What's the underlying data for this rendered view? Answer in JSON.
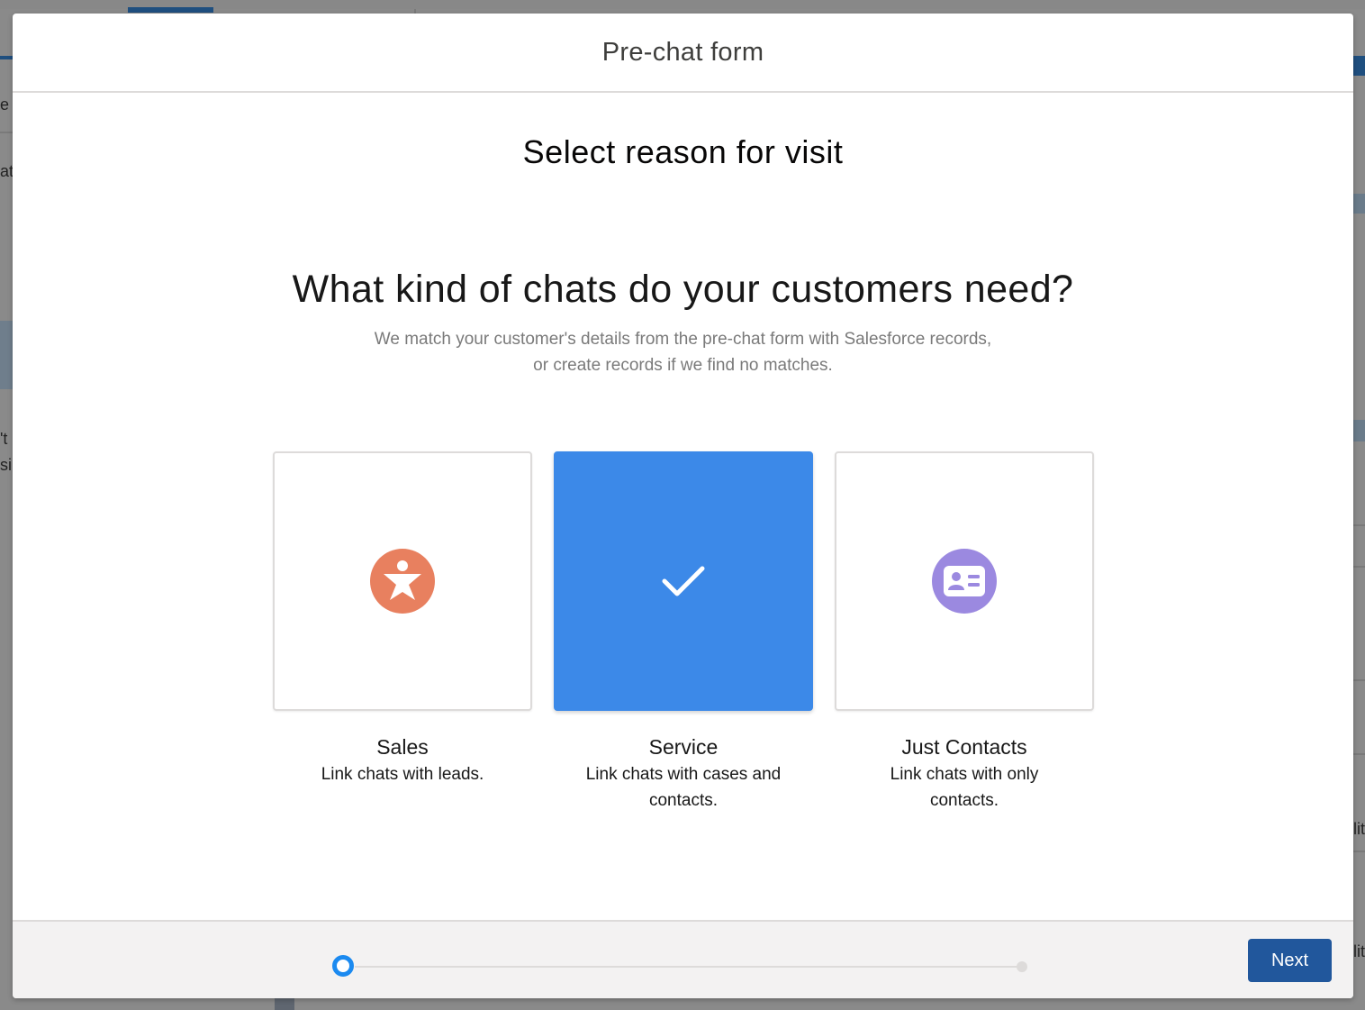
{
  "background": {
    "fragments": [
      {
        "text": "e"
      },
      {
        "text": "at"
      },
      {
        "text": "'t"
      },
      {
        "text": "si"
      },
      {
        "text": "lit"
      },
      {
        "text": "lit"
      }
    ]
  },
  "modal": {
    "title": "Pre-chat form",
    "step_title": "Select reason for visit",
    "question": "What kind of chats do your customers need?",
    "subtitle_line1": "We match your customer's details from the pre-chat form with Salesforce records,",
    "subtitle_line2": "or create records if we find no matches.",
    "options": [
      {
        "name": "Sales",
        "description": "Link chats with leads.",
        "icon": "lead-person-icon",
        "color": "#e8805f",
        "selected": false
      },
      {
        "name": "Service",
        "description": "Link chats with cases and contacts.",
        "icon": "checkmark-icon",
        "color": "#3c89e8",
        "selected": true
      },
      {
        "name": "Just Contacts",
        "description": "Link chats with only contacts.",
        "icon": "contact-card-icon",
        "color": "#9b89e0",
        "selected": false
      }
    ],
    "footer": {
      "progress_value": 0,
      "next_label": "Next"
    }
  },
  "colors": {
    "accent": "#3c89e8",
    "primary_button": "#21579c",
    "progress_active": "#1b8af0"
  }
}
